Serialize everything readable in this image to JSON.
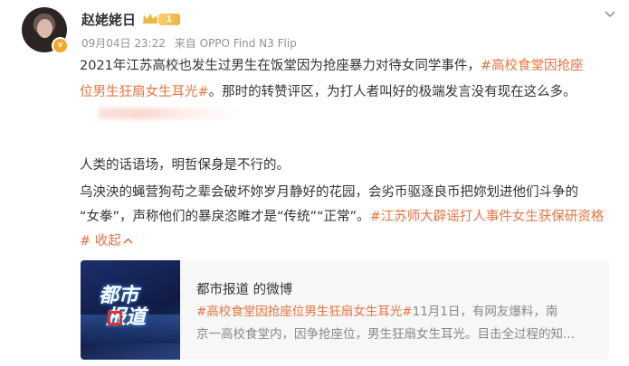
{
  "post": {
    "username": "赵姥姥日",
    "level": "1",
    "verified_badge": "v",
    "time": "09月04日 23:22",
    "source": "来自 OPPO Find N3 Flip",
    "line1": "2021年江苏高校也发生过男生在饭堂因为抢座暴力对待女同学事件，",
    "tag1_part1": "#高校食堂因抢座",
    "tag1_part2": "位男生狂扇女生耳光#",
    "line2_rest": "。那时的转赞评区，为打人者叫好的极端发言没有现在这么多。",
    "line4": "人类的话语场，明哲保身是不行的。",
    "line5": "乌泱泱的蝇营狗苟之辈会破坏妳岁月静好的花园，会劣币驱逐良币把妳划进他们斗争的",
    "line6": "“女拳”，声称他们的暴戾恣睢才是“传统”“正常”。",
    "tag2": "#江苏师大辟谣打人事件女生获保研资格",
    "tag2_end": "#",
    "collapse": "收起"
  },
  "card": {
    "thumb_text1": "都市",
    "thumb_text2": "报道",
    "title": "都市报道 的微博",
    "desc_tag": "#高校食堂因抢座位男生狂扇女生耳光#",
    "desc_line1_rest": "11月1日，有网友爆料，南",
    "desc_line2": "京一高校食堂内，因争抢座位，男生狂扇女生耳光。目击全过程的知..."
  },
  "colors": {
    "link": "#eb7340",
    "text": "#333333",
    "meta": "#939393",
    "badge": "#f6a623"
  },
  "icons": [
    "chevron-down-icon",
    "crown-icon",
    "verified-v-icon",
    "collapse-chevron-icon"
  ]
}
